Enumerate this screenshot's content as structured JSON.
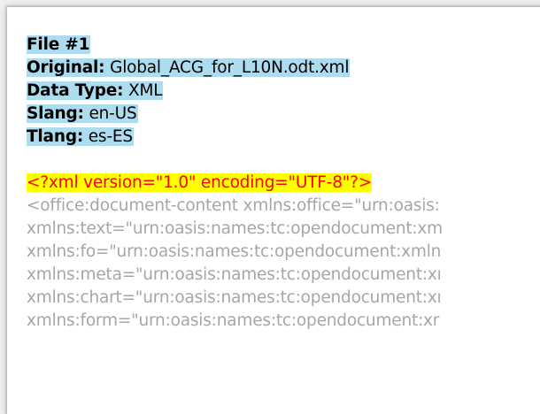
{
  "file": {
    "title": "File #1",
    "original_label": "Original:",
    "original_value": "Global_ACG_for_L10N.odt.xml",
    "datatype_label": "Data Type:",
    "datatype_value": "XML",
    "slang_label": "Slang:",
    "slang_value": "en-US",
    "tlang_label": "Tlang:",
    "tlang_value": "es-ES"
  },
  "xml": {
    "declaration": "<?xml version=\"1.0\" encoding=\"UTF-8\"?>",
    "lines": [
      "<office:document-content xmlns:office=\"urn:oasis:",
      "xmlns:text=\"urn:oasis:names:tc:opendocument:xm",
      "xmlns:fo=\"urn:oasis:names:tc:opendocument:xmln",
      "xmlns:meta=\"urn:oasis:names:tc:opendocument:xı",
      "xmlns:chart=\"urn:oasis:names:tc:opendocument:xı",
      "xmlns:form=\"urn:oasis:names:tc:opendocument:xr"
    ]
  },
  "colors": {
    "meta_highlight": "#aedcef",
    "decl_highlight": "#ffff00",
    "decl_text": "#ff0000",
    "xml_text": "#a6a6a6"
  }
}
